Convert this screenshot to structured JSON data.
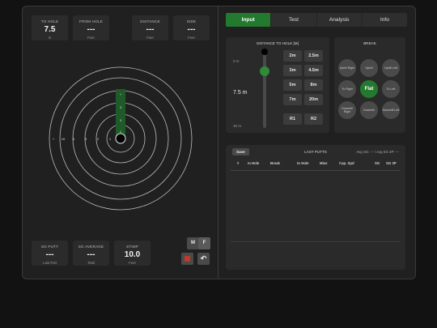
{
  "stats": {
    "to_hole": {
      "title": "TO HOLE",
      "value": "7.5",
      "unit": "m"
    },
    "from_hole": {
      "title": "FROM HOLE",
      "value": "---",
      "unit": "Feet"
    },
    "distance": {
      "title": "DISTANCE",
      "value": "---",
      "unit": "Feet"
    },
    "side": {
      "title": "SIDE",
      "value": "---",
      "unit": "Feet"
    }
  },
  "target": {
    "ring_labels": [
      "3",
      "2",
      "3",
      "6",
      "10"
    ],
    "ring_label_x": [
      "1",
      "2",
      "3",
      "6",
      "10"
    ],
    "plus_label": "+",
    "green_labels": [
      "+",
      "3",
      "3",
      "1"
    ]
  },
  "bottom": {
    "sg_putt": {
      "title": "SG PUTT",
      "value": "---",
      "unit": "Last Putt"
    },
    "sg_average": {
      "title": "SG AVERAGE",
      "value": "---",
      "unit": "Total"
    },
    "stimp": {
      "title": "STIMP",
      "value": "10.0",
      "unit": "Feet"
    },
    "m_label": "M",
    "f_label": "F",
    "stop_color": "#c0392b",
    "undo_glyph": "↶"
  },
  "tabs": [
    {
      "label": "Input"
    },
    {
      "label": "Test"
    },
    {
      "label": "Analysis"
    },
    {
      "label": "Info"
    }
  ],
  "distance_panel": {
    "title": "DISTANCE TO HOLE [M]",
    "top_label": "0 m",
    "current": "7.5 m",
    "bottom_label": "30 m",
    "slider_fraction": 0.25,
    "buttons": [
      "2m",
      "2.5m",
      "3m",
      "4.5m",
      "5m",
      "8m",
      "7m",
      "20m"
    ],
    "r1": "R1",
    "r2": "R2"
  },
  "break_panel": {
    "title": "BREAK",
    "options": [
      "Uphill Right",
      "Uphill",
      "Uphill Left",
      "To Right",
      "Flat",
      "To Left",
      "Downhill Right",
      "Downhill",
      "Downhill Left"
    ],
    "selected": "Flat"
  },
  "putts": {
    "save_label": "Save",
    "title": "LAST PUTTS",
    "avg_text": "Avg SG: --- / Avg SG 3P: ---",
    "columns": [
      "#",
      "m Hole",
      "Break",
      "to Hole",
      "Miss",
      "Cap. Spd",
      "SG",
      "SG 3P"
    ]
  },
  "colors": {
    "accent": "#237a2e",
    "panel": "#2a2a2a",
    "background": "#121212"
  }
}
